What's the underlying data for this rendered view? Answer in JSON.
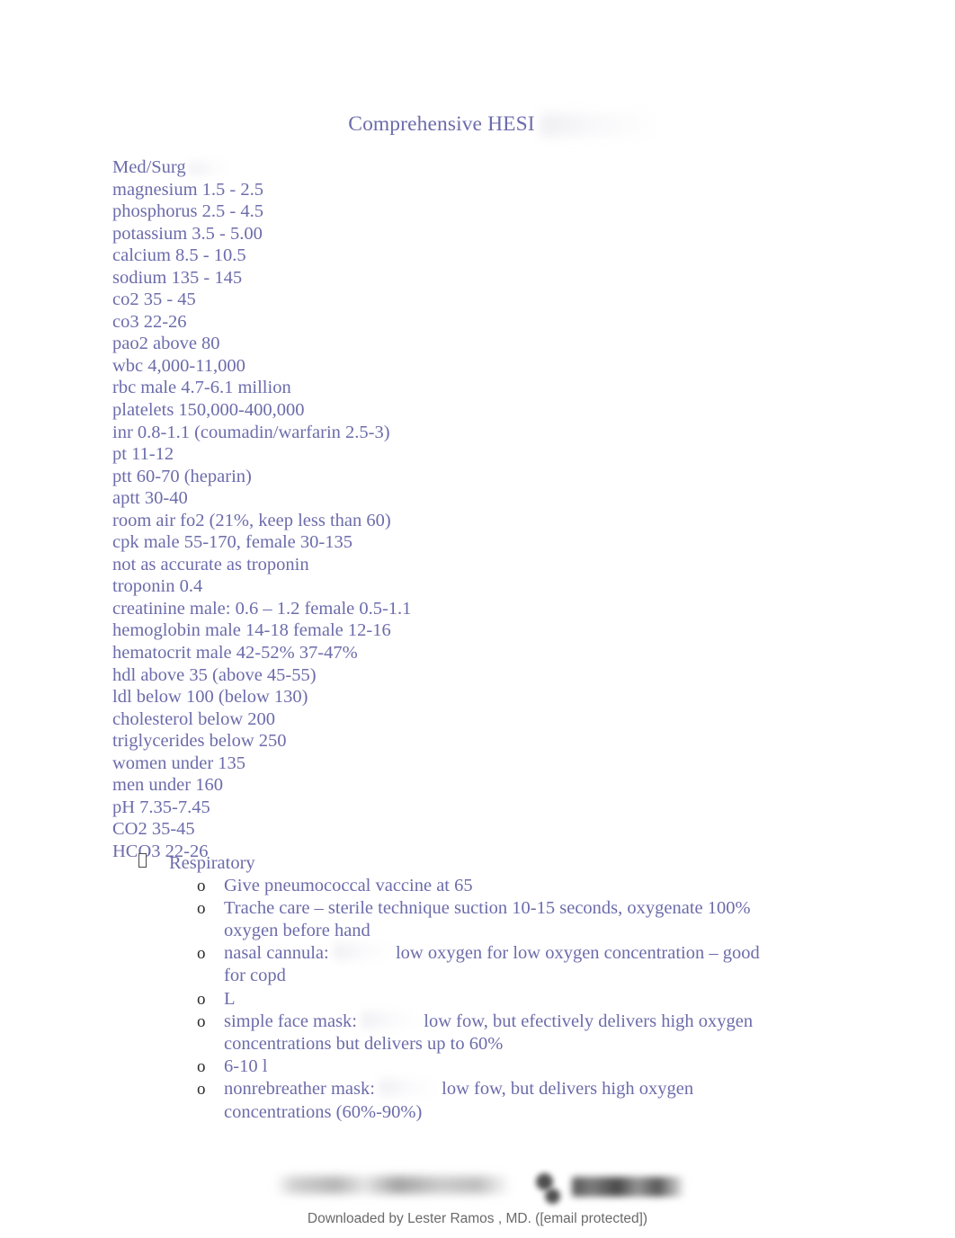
{
  "document": {
    "title": "Comprehensive HESI",
    "title_redaction": "blurred-watermark"
  },
  "lab_values": {
    "heading": "Med/Surg",
    "lines": [
      "magnesium 1.5 - 2.5",
      "phosphorus 2.5 - 4.5",
      "potassium 3.5 - 5.00",
      "calcium 8.5 - 10.5",
      "sodium 135 - 145",
      "co2 35 - 45",
      "co3 22-26",
      "pao2 above 80",
      "wbc 4,000-11,000",
      "rbc male 4.7-6.1 million",
      "platelets 150,000-400,000",
      "inr 0.8-1.1 (coumadin/warfarin 2.5-3)",
      "pt 11-12",
      "ptt 60-70 (heparin)",
      "aptt 30-40",
      "room air fo2 (21%, keep less than 60)",
      "cpk male 55-170, female 30-135",
      "not as accurate as troponin",
      "troponin 0.4",
      "creatinine male: 0.6 – 1.2 female 0.5-1.1",
      "hemoglobin male 14-18 female 12-16",
      "hematocrit male 42-52% 37-47%",
      "hdl above 35 (above 45-55)",
      "ldl below 100 (below 130)",
      "cholesterol below 200",
      "triglycerides below 250",
      "women under 135",
      "men under 160",
      "pH 7.35-7.45",
      "CO2 35-45",
      "HCO3 22-26"
    ]
  },
  "outline": {
    "section_label": "Respiratory",
    "section_marker": "missing-glyph-box",
    "sub_marker": "o",
    "items": [
      {
        "text_before": "Give pneumococcal vaccine at 65",
        "redacted_gap": false,
        "text_after": ""
      },
      {
        "text_before": "Trache care – sterile technique suction 10-15 seconds, oxygenate 100% oxygen before hand",
        "redacted_gap": false,
        "text_after": ""
      },
      {
        "text_before": "nasal cannula:",
        "redacted_gap": true,
        "text_after": "low oxygen for low oxygen concentration – good for copd"
      },
      {
        "text_before": "L",
        "redacted_gap": false,
        "text_after": ""
      },
      {
        "text_before": "simple face mask:",
        "redacted_gap": true,
        "text_after": "low fow, but efectively delivers high oxygen concentrations but delivers up to 60%"
      },
      {
        "text_before": "6-10 l",
        "redacted_gap": false,
        "text_after": ""
      },
      {
        "text_before": "nonrebreather mask:",
        "redacted_gap": true,
        "text_after": "low fow, but delivers high oxygen concentrations (60%-90%)"
      }
    ]
  },
  "footer": {
    "attribution": "Downloaded by Lester Ramos , MD. ([email protected])",
    "watermark": "blurred-logo-and-wordmark"
  },
  "colors": {
    "body_text": "#6c6cab",
    "marker_text": "#2b2b2b",
    "footer_text": "#6a6a6a",
    "page_background": "#ffffff"
  }
}
